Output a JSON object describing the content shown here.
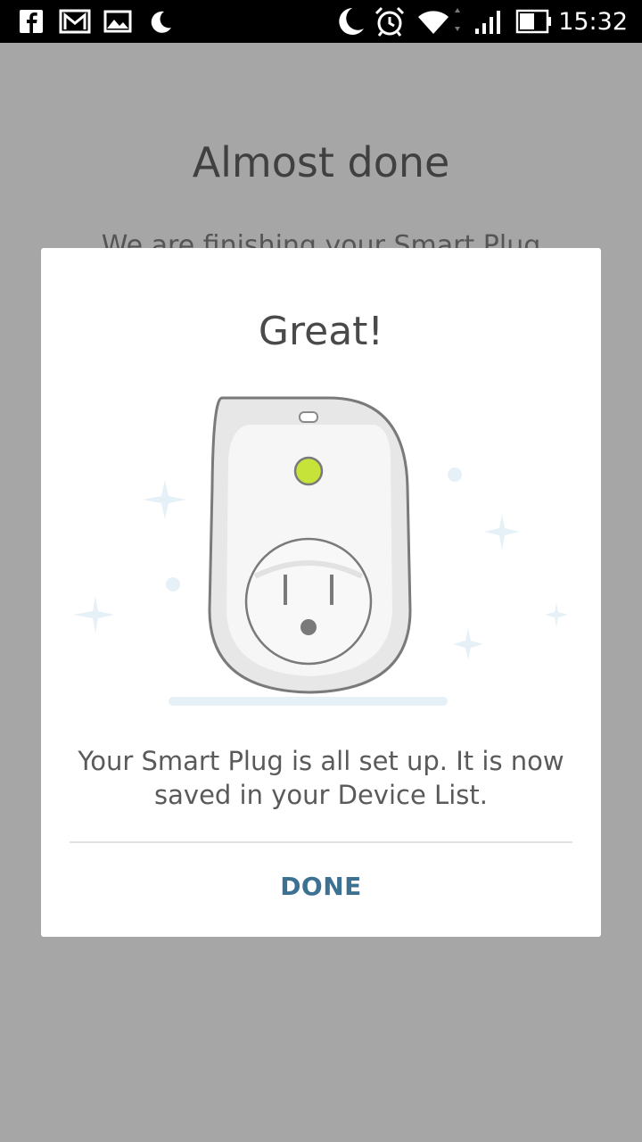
{
  "status_bar": {
    "time": "15:32",
    "left_icons": [
      "facebook-icon",
      "gmail-icon",
      "gallery-icon",
      "moon-icon"
    ],
    "right_icons": [
      "moon-icon",
      "alarm-icon",
      "wifi-icon",
      "signal-icon",
      "battery-icon"
    ]
  },
  "background": {
    "title": "Almost done",
    "subtitle": "We are finishing your Smart Plug"
  },
  "dialog": {
    "title": "Great!",
    "message": "Your Smart Plug is all set up. It is now saved in your Device List.",
    "done_label": "DONE",
    "illustration": "smart-plug-icon"
  },
  "colors": {
    "scrim_background": "#a6a6a6",
    "dialog_background": "#ffffff",
    "accent": "#3d7191",
    "plug_led": "#c6e33a",
    "sparkle": "#e6f1f7"
  }
}
